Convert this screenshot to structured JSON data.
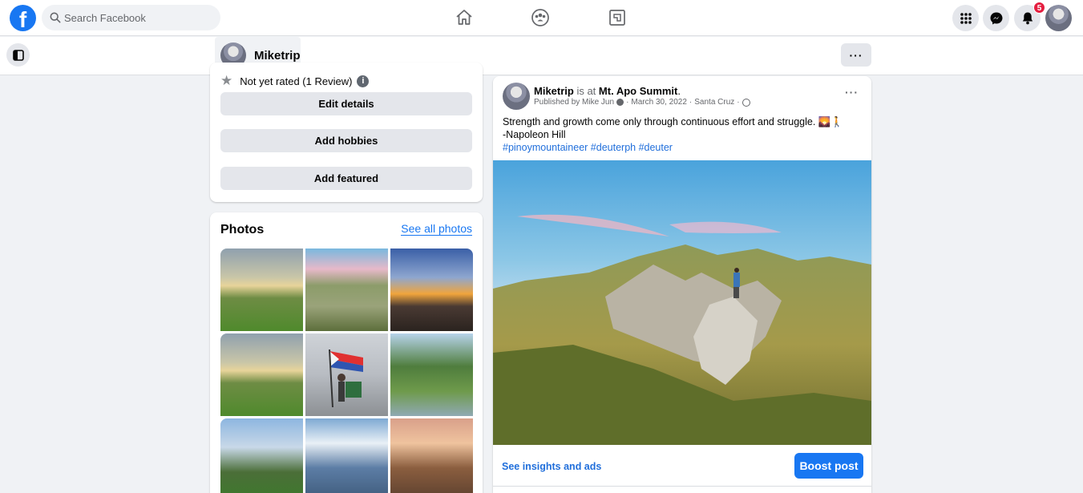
{
  "topbar": {
    "logo": "f",
    "search_placeholder": "Search Facebook",
    "notifications_count": "5"
  },
  "subbar": {
    "page_name": "Miketrip",
    "more": "···"
  },
  "intro": {
    "rating_text": "Not yet rated (1 Review)",
    "info_glyph": "i",
    "buttons": [
      "Edit details",
      "Add hobbies",
      "Add featured"
    ]
  },
  "photos": {
    "title": "Photos",
    "see_all": "See all photos"
  },
  "post": {
    "author": "Miketrip",
    "is_at": " is at ",
    "location": "Mt. Apo Summit",
    "published_by": "Published by Mike Jun",
    "date": "March 30, 2022",
    "place": "Santa Cruz",
    "more": "···",
    "text_line1": "Strength and growth come only through continuous effort and struggle. 🌄🚶",
    "text_line2": "-Napoleon Hill",
    "hashtags": "#pinoymountaineer #deuterph #deuter",
    "insights": "See insights and ads",
    "boost": "Boost post"
  },
  "colors": {
    "brand": "#1877f2",
    "link": "#216fdb",
    "badge": "#e41e3f"
  }
}
